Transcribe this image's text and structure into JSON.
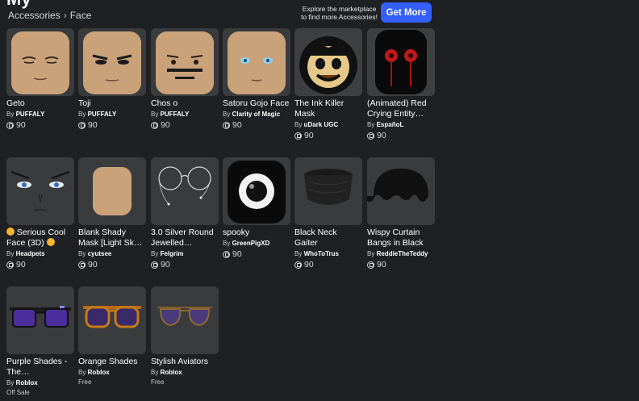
{
  "breadcrumb": {
    "parent": "Accessories",
    "current": "Face"
  },
  "promo": {
    "line1": "Explore the marketplace",
    "line2": "to find more Accessories!",
    "button": "Get More"
  },
  "items": [
    {
      "name": "Geto",
      "creator": "PUFFALY",
      "price": "90"
    },
    {
      "name": "Toji",
      "creator": "PUFFALY",
      "price": "90"
    },
    {
      "name": "Chos o",
      "creator": "PUFFALY",
      "price": "90"
    },
    {
      "name": "Satoru Gojo Face",
      "creator": "Clarity of Magic",
      "price": "90"
    },
    {
      "name": "The Ink Killer Mask",
      "creator": "uDark UGC",
      "price": "90"
    },
    {
      "name": "(Animated) Red Crying Entity…",
      "creator": "EspañoL",
      "price": "90"
    },
    {
      "name": "Serious Cool Face (3D)",
      "creator": "Headpets",
      "price": "90"
    },
    {
      "name": "Blank Shady Mask [Light Sk…",
      "creator": "cyutsee",
      "price": "90"
    },
    {
      "name": "3.0 Silver Round Jewelled…",
      "creator": "Felgrim",
      "price": "90"
    },
    {
      "name": "spooky",
      "creator": "GreenPigXD",
      "price": "90"
    },
    {
      "name": "Black Neck Gaiter",
      "creator": "WhoToTrus",
      "price": "90"
    },
    {
      "name": "Wispy Curtain Bangs in Black",
      "creator": "ReddieTheTeddy",
      "price": "90"
    },
    {
      "name": "Purple Shades - The…",
      "creator": "Roblox",
      "price": "Off Sale"
    },
    {
      "name": "Orange Shades",
      "creator": "Roblox",
      "price": "Free"
    },
    {
      "name": "Stylish Aviators",
      "creator": "Roblox",
      "price": "Free"
    }
  ],
  "labels": {
    "by": "By"
  }
}
